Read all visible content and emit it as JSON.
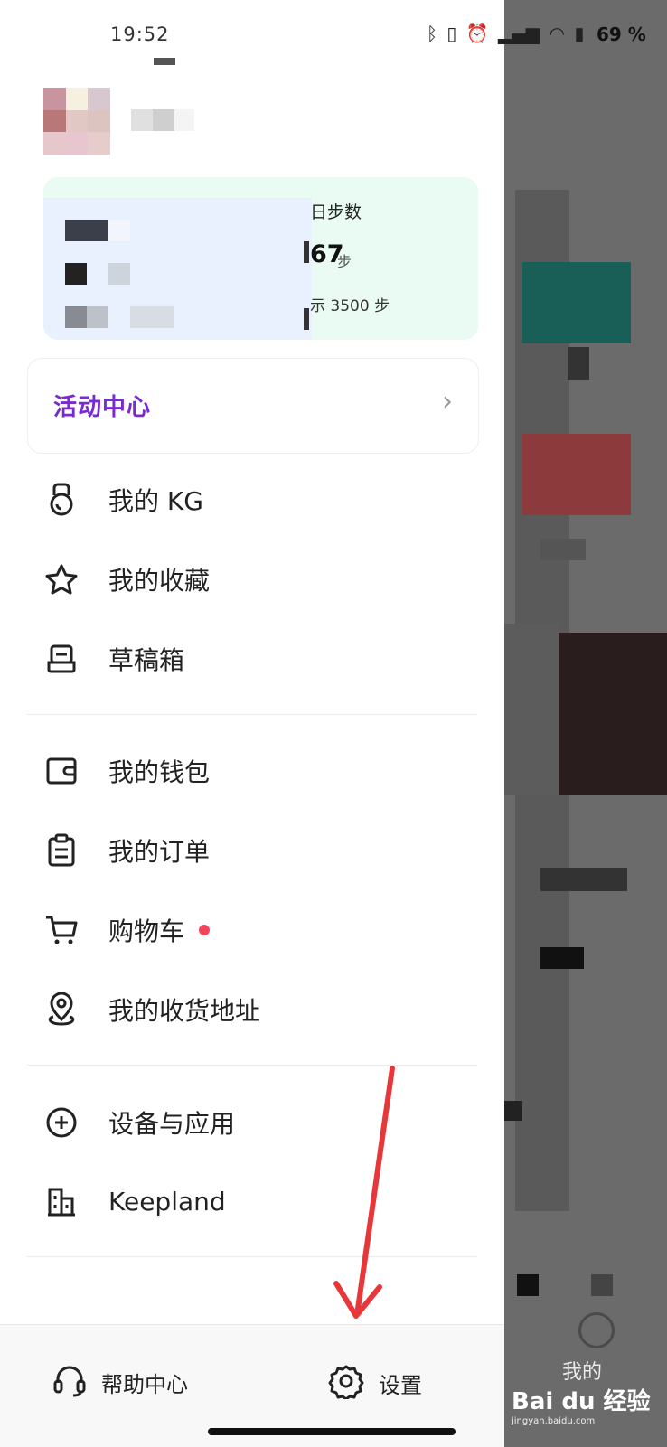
{
  "status_bar": {
    "time": "19:52",
    "battery": "69 %"
  },
  "steps": {
    "title": "日步数",
    "value": "67",
    "unit": "步",
    "goal": "示 3500 步"
  },
  "activity": {
    "label": "活动中心"
  },
  "menu": [
    {
      "name": "my-kg",
      "label": "我的 KG",
      "icon": "kettlebell-icon"
    },
    {
      "name": "my-favorites",
      "label": "我的收藏",
      "icon": "star-icon"
    },
    {
      "name": "drafts",
      "label": "草稿箱",
      "icon": "drafts-box-icon"
    },
    {
      "name": "my-wallet",
      "label": "我的钱包",
      "icon": "wallet-icon"
    },
    {
      "name": "my-orders",
      "label": "我的订单",
      "icon": "clipboard-icon"
    },
    {
      "name": "shopping-cart",
      "label": "购物车",
      "icon": "cart-icon"
    },
    {
      "name": "my-address",
      "label": "我的收货地址",
      "icon": "location-pin-icon"
    },
    {
      "name": "devices-apps",
      "label": "设备与应用",
      "icon": "plus-circle-icon"
    },
    {
      "name": "keepland",
      "label": "Keepland",
      "icon": "building-icon"
    }
  ],
  "bottom": {
    "help": "帮助中心",
    "settings": "设置"
  },
  "background_tab_label": "我的",
  "watermark": {
    "brand": "Bai du 经验",
    "url": "jingyan.baidu.com"
  },
  "colors": {
    "accent_red": "#f3445a",
    "arrow_red": "#e8373a",
    "steps_green_bg": "#e9fbf2",
    "activity_purple": "#7a2bd0"
  }
}
